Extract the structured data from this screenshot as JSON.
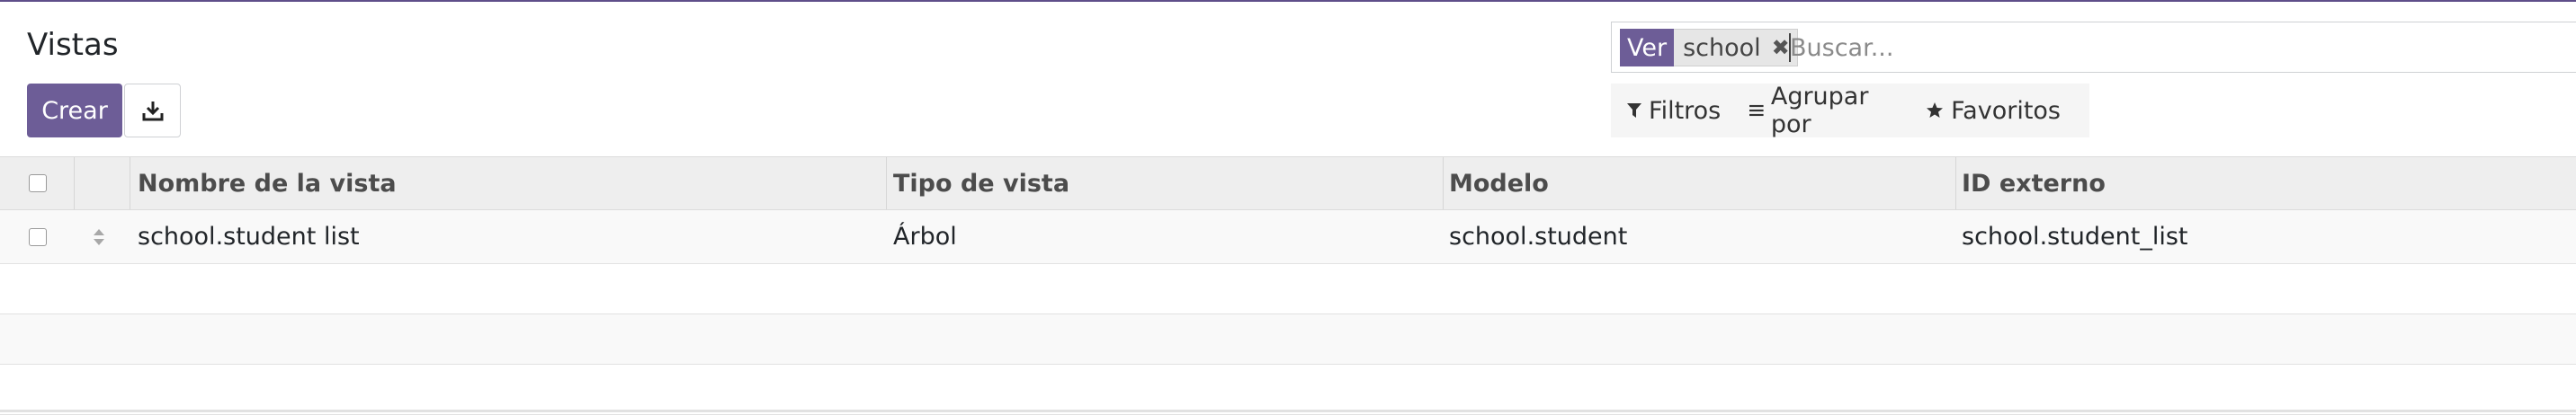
{
  "page": {
    "title": "Vistas",
    "create_label": "Crear",
    "download_icon": "download-icon"
  },
  "search": {
    "facet_label": "Ver",
    "facet_value": "school",
    "placeholder": "Buscar..."
  },
  "filters": {
    "filters_label": "Filtros",
    "groupby_label": "Agrupar por",
    "favorites_label": "Favoritos"
  },
  "table": {
    "columns": [
      "Nombre de la vista",
      "Tipo de vista",
      "Modelo",
      "ID externo"
    ],
    "rows": [
      [
        "school.student list",
        "Árbol",
        "school.student",
        "school.student_list"
      ]
    ]
  },
  "colors": {
    "accent": "#6d5d97",
    "header_bg": "#eeeeee"
  }
}
